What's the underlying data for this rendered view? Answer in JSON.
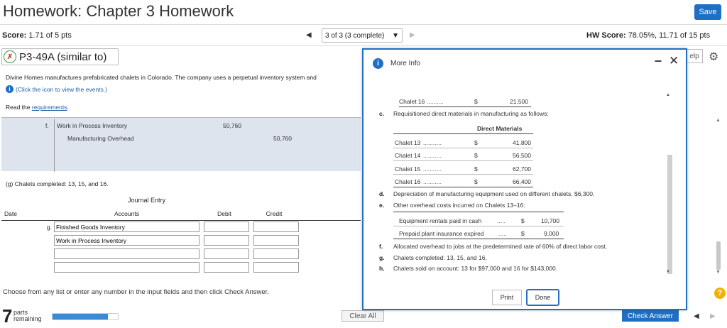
{
  "header": {
    "title": "Homework: Chapter 3 Homework",
    "save": "Save",
    "score_label": "Score:",
    "score_value": "1.71 of 5 pts",
    "nav_prev": "◀",
    "nav_select": "3 of 3 (3 complete)",
    "nav_next": "▶",
    "hw_score_label": "HW Score:",
    "hw_score_value": "78.05%, 11.71 of 15 pts"
  },
  "question": {
    "id": "P3-49A (similar to)",
    "help": "elp",
    "intro": "Divine Homes manufactures prefabricated chalets in Colorado. The company uses a perpetual inventory system and",
    "events_link": "(Click the icon to view the events.)",
    "read_prefix": "Read the ",
    "requirements_link": "requirements",
    "requirements_suffix": ".",
    "prev_entry": {
      "letter": "f.",
      "debit_account": "Work in Process Inventory",
      "credit_account": "Manufacturing Overhead",
      "debit_value": "50,760",
      "credit_value": "50,760"
    },
    "g_text": "(g) Chalets completed: 13, 15, and 16.",
    "journal_title": "Journal Entry",
    "columns": {
      "date": "Date",
      "accounts": "Accounts",
      "debit": "Debit",
      "credit": "Credit"
    },
    "row_letter": "g.",
    "rows": [
      {
        "account": "Finished Goods Inventory"
      },
      {
        "account": "Work in Process Inventory"
      },
      {
        "account": ""
      },
      {
        "account": ""
      }
    ],
    "instructions": "Choose from any list or enter any number in the input fields and then click Check Answer.",
    "parts_count": "7",
    "parts_label_1": "parts",
    "parts_label_2": "remaining",
    "progress_fraction": 0.85,
    "clear_all": "Clear All",
    "check_answer": "Check Answer"
  },
  "modal": {
    "title": "More Info",
    "top_row": {
      "label": "Chalet 16",
      "dollar": "$",
      "value": "21,500"
    },
    "c_letter": "c.",
    "c_text": "Requisitioned direct materials in manufacturing as follows:",
    "dm_header": "Direct Materials",
    "dm_rows": [
      {
        "label": "Chalet 13",
        "dollar": "$",
        "value": "41,800"
      },
      {
        "label": "Chalet 14",
        "dollar": "$",
        "value": "56,500"
      },
      {
        "label": "Chalet 15",
        "dollar": "$",
        "value": "62,700"
      },
      {
        "label": "Chalet 16",
        "dollar": "$",
        "value": "66,400"
      }
    ],
    "d_letter": "d.",
    "d_text": "Depreciation of manufacturing equipment used on different chalets, $6,300.",
    "e_letter": "e.",
    "e_text": "Other overhead costs incurred on Chalets 13–16:",
    "e_rows": [
      {
        "label": "Equipment rentals paid in cash",
        "dollar": "$",
        "value": "10,700"
      },
      {
        "label": "Prepaid plant insurance expired",
        "dollar": "$",
        "value": "9,000"
      }
    ],
    "f_letter": "f.",
    "f_text": "Allocated overhead to jobs at the predetermined rate of 60% of direct labor cost.",
    "g_letter": "g.",
    "g_text": "Chalets completed: 13, 15, and 16.",
    "h_letter": "h.",
    "h_text": "Chalets sold on account: 13 for $97,000 and 16 for $143,000.",
    "print": "Print",
    "done": "Done"
  },
  "colors": {
    "accent": "#1f6fc4",
    "selected_bg": "#dde4ee",
    "help_yellow": "#f0b400"
  }
}
